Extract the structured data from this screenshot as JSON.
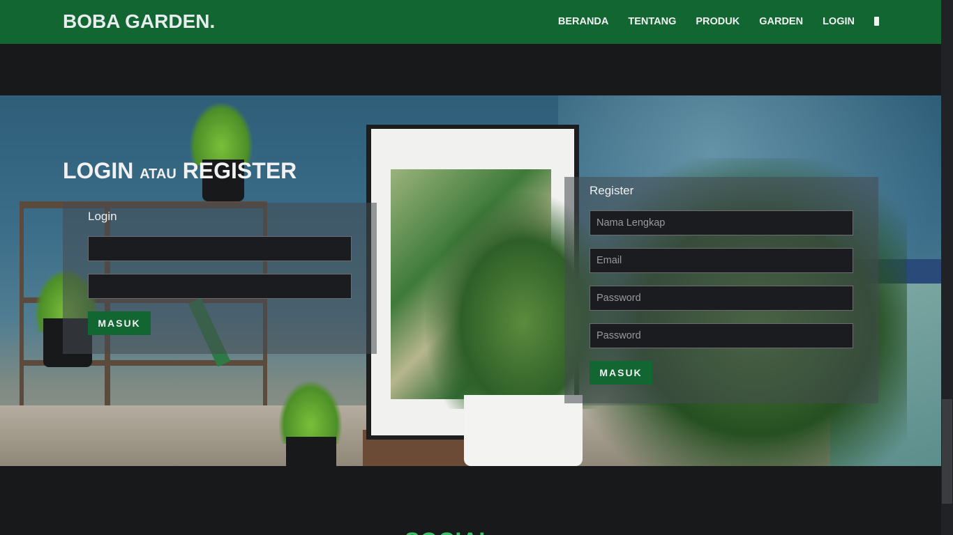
{
  "navbar": {
    "brand": "BOBA GARDEN.",
    "items": [
      {
        "label": "BERANDA"
      },
      {
        "label": "TENTANG"
      },
      {
        "label": "PRODUK"
      },
      {
        "label": "GARDEN"
      },
      {
        "label": "LOGIN"
      }
    ],
    "cart_icon": "cart-icon",
    "bg_color": "#116632"
  },
  "hero": {
    "title_main": "LOGIN",
    "title_small": "ATAU",
    "title_end": "REGISTER"
  },
  "login": {
    "label": "Login",
    "username_placeholder": "",
    "password_placeholder": "",
    "submit_label": "MASUK"
  },
  "register": {
    "label": "Register",
    "name_placeholder": "Nama Lengkap",
    "email_placeholder": "Email",
    "password_placeholder": "Password",
    "confirm_placeholder": "Password",
    "submit_label": "MASUK"
  },
  "footer": {
    "social_heading": "SOCIAL"
  },
  "colors": {
    "accent": "#116632",
    "background": "#18191b",
    "social_heading": "#3fbf6a"
  }
}
